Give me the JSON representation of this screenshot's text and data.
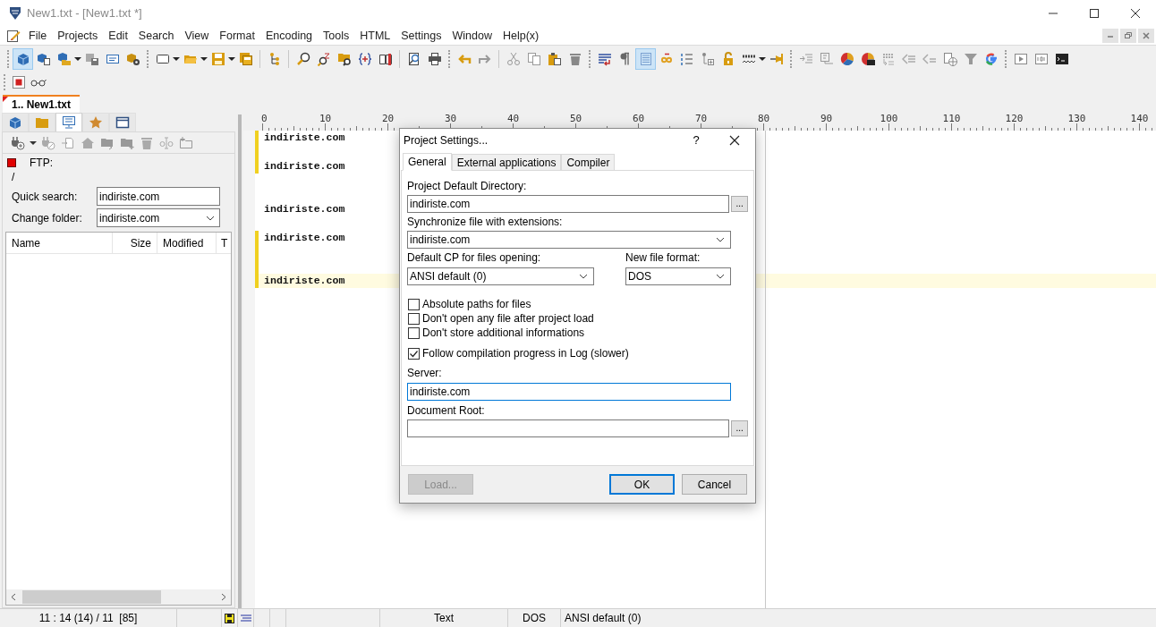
{
  "window": {
    "title": "New1.txt - [New1.txt *]"
  },
  "menu": [
    "File",
    "Projects",
    "Edit",
    "Search",
    "View",
    "Format",
    "Encoding",
    "Tools",
    "HTML",
    "Settings",
    "Window",
    "Help(x)"
  ],
  "toolbar": {
    "buttons": [
      {
        "pressed": true
      },
      {
        "pressed": false
      },
      {
        "pressed": false
      },
      {
        "pressed": false
      },
      {
        "pressed": false
      },
      {
        "pressed": false
      },
      {
        "pressed": false
      },
      {
        "pressed": false
      },
      {
        "pressed": false
      },
      {
        "pressed": false
      },
      {
        "pressed": false
      },
      {
        "pressed": false
      },
      {
        "pressed": false
      },
      {
        "pressed": false
      },
      {
        "pressed": false
      },
      {
        "pressed": false
      },
      {
        "pressed": false
      },
      {
        "pressed": false
      },
      {
        "pressed": false
      },
      {
        "pressed": false
      },
      {
        "pressed": false
      },
      {
        "pressed": false
      },
      {
        "pressed": false
      },
      {
        "pressed": false
      },
      {
        "pressed": false
      },
      {
        "pressed": false
      },
      {
        "pressed": true
      },
      {
        "pressed": false
      },
      {
        "pressed": false
      },
      {
        "pressed": false
      },
      {
        "pressed": false
      },
      {
        "pressed": false
      },
      {
        "pressed": false
      },
      {
        "pressed": false
      },
      {
        "pressed": false
      },
      {
        "pressed": false
      },
      {
        "pressed": false
      },
      {
        "pressed": false
      },
      {
        "pressed": false
      },
      {
        "pressed": false
      },
      {
        "pressed": false
      },
      {
        "pressed": false
      },
      {
        "pressed": false
      },
      {
        "pressed": false
      },
      {
        "pressed": false
      },
      {
        "pressed": false
      }
    ]
  },
  "document_tabs": [
    {
      "label": "1.. New1.txt",
      "selected": true
    }
  ],
  "left_panel": {
    "tabs": [
      {
        "selected": false
      },
      {
        "selected": false
      },
      {
        "selected": true
      },
      {
        "selected": false
      },
      {
        "selected": false
      }
    ],
    "ftp": {
      "label": "FTP:",
      "connected": false
    },
    "path": "/",
    "quick_search": {
      "label": "Quick search:",
      "value": "indiriste.com"
    },
    "change_folder": {
      "label": "Change folder:",
      "value": "indiriste.com"
    },
    "list_columns": [
      "Name",
      "Size",
      "Modified",
      "T"
    ]
  },
  "editor": {
    "ruler": [
      "0",
      "10",
      "20",
      "30",
      "40",
      "50",
      "60",
      "70",
      "80",
      "90",
      "100",
      "110",
      "120",
      "130",
      "140"
    ],
    "lines": [
      {
        "text": "indiriste.com",
        "modified": true,
        "current": false
      },
      {
        "modified": true,
        "current": false
      },
      {
        "text": "indiriste.com",
        "modified": true,
        "current": false
      },
      {
        "modified": false,
        "current": false
      },
      {
        "modified": false,
        "current": false
      },
      {
        "text": "indiriste.com",
        "modified": false,
        "current": false
      },
      {
        "modified": false,
        "current": false
      },
      {
        "text": "indiriste.com",
        "modified": true,
        "current": false
      },
      {
        "modified": true,
        "current": false
      },
      {
        "modified": true,
        "current": false
      },
      {
        "text": "indiriste.com",
        "modified": true,
        "current": true
      }
    ]
  },
  "dialog": {
    "title": "Project Settings...",
    "help": "?",
    "tabs": [
      {
        "label": "General",
        "selected": true
      },
      {
        "label": "External applications",
        "selected": false
      },
      {
        "label": "Compiler",
        "selected": false
      }
    ],
    "project_directory": {
      "label": "Project Default Directory:",
      "value": "indiriste.com",
      "browse": "..."
    },
    "sync_extensions": {
      "label": "Synchronize file with extensions:",
      "value": "indiriste.com"
    },
    "default_cp": {
      "label": "Default CP for files opening:",
      "value": "ANSI default (0)"
    },
    "new_file_format": {
      "label": "New file format:",
      "value": "DOS"
    },
    "options": [
      {
        "label": "Absolute paths for files",
        "checked": false
      },
      {
        "label": "Don't open any file after project load",
        "checked": false
      },
      {
        "label": "Don't store additional informations",
        "checked": false
      },
      {
        "label": "Follow compilation progress in Log (slower)",
        "checked": true
      }
    ],
    "server": {
      "label": "Server:",
      "value": "indiriste.com",
      "focused": true
    },
    "document_root": {
      "label": "Document Root:",
      "browse": "..."
    },
    "buttons": [
      {
        "label": "Load...",
        "disabled": true,
        "default": false
      },
      {
        "label": "OK",
        "disabled": false,
        "default": true
      },
      {
        "label": "Cancel",
        "disabled": false,
        "default": false
      }
    ]
  },
  "status_bar": {
    "position": "11 : 14 (14) / 11  [85]",
    "mode": "Text",
    "line_ending": "DOS",
    "encoding": "ANSI default (0)"
  }
}
